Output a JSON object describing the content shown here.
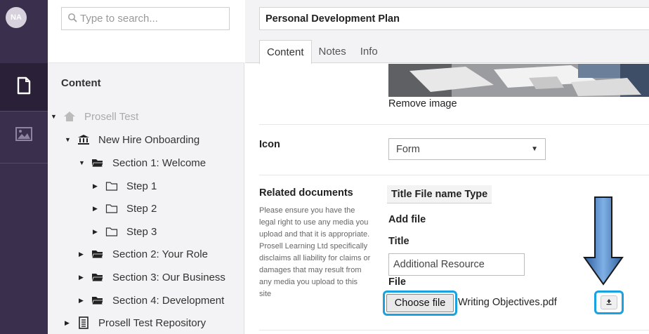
{
  "user": {
    "initials": "NA"
  },
  "rail": {
    "items": [
      {
        "icon": "document-icon",
        "active": true
      },
      {
        "icon": "image-icon",
        "active": false
      }
    ]
  },
  "search": {
    "placeholder": "Type to search..."
  },
  "tree": {
    "title": "Content",
    "nodes": [
      {
        "label": "Prosell Test",
        "icon": "home-icon",
        "expanded": true
      },
      {
        "label": "New Hire Onboarding",
        "icon": "bank-icon",
        "expanded": true
      },
      {
        "label": "Section 1: Welcome",
        "icon": "folder-open-icon",
        "expanded": true
      },
      {
        "label": "Step 1",
        "icon": "folder-icon",
        "expanded": false
      },
      {
        "label": "Step 2",
        "icon": "folder-icon",
        "expanded": false
      },
      {
        "label": "Step 3",
        "icon": "folder-icon",
        "expanded": false
      },
      {
        "label": "Section 2: Your Role",
        "icon": "folder-open-icon",
        "expanded": false
      },
      {
        "label": "Section 3: Our Business",
        "icon": "folder-open-icon",
        "expanded": false
      },
      {
        "label": "Section 4: Development",
        "icon": "folder-open-icon",
        "expanded": false
      },
      {
        "label": "Prosell Test Repository",
        "icon": "book-icon",
        "expanded": false
      }
    ]
  },
  "document": {
    "title": "Personal Development Plan",
    "tabs": [
      "Content",
      "Notes",
      "Info"
    ],
    "active_tab": "Content",
    "remove_image": "Remove image",
    "icon_field": {
      "label": "Icon",
      "value": "Form"
    },
    "related": {
      "label": "Related documents",
      "help": "Please ensure you have the legal right to use any media you upload and that it is appropriate. Prosell Learning Ltd specifically disclaims all liability for claims or damages that may result from any media you upload to this site",
      "columns": [
        "Title",
        "File name",
        "Type"
      ],
      "add_file": "Add file",
      "title_label": "Title",
      "title_value": "Additional Resource",
      "file_label": "File",
      "choose_button": "Choose file",
      "file_name": "Writing Objectives.pdf"
    }
  },
  "colors": {
    "rail": "#3b2f4e",
    "highlight": "#1aa2e0",
    "arrow": "#4a86c8"
  }
}
